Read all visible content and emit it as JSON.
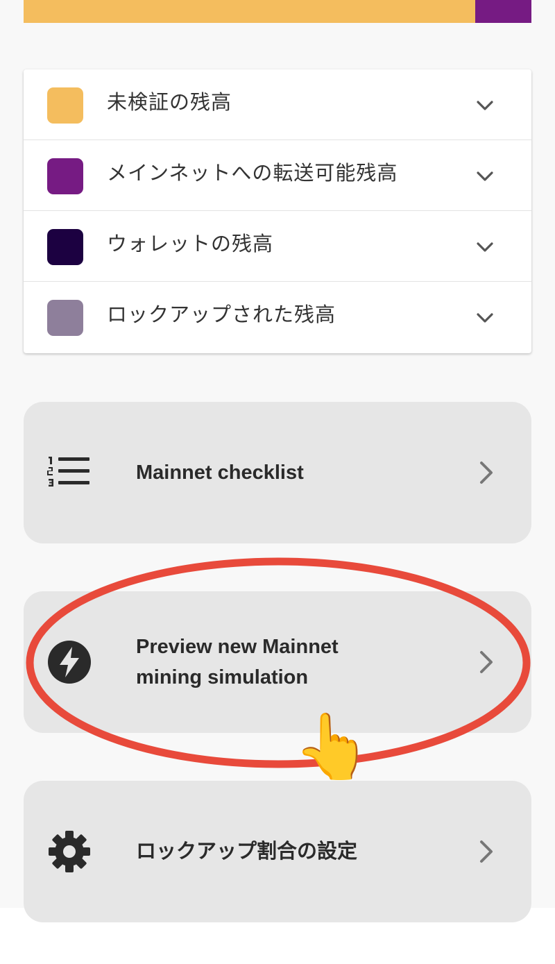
{
  "balance_bar": {
    "segments": [
      {
        "name": "未検証の残高",
        "fraction": 0.89,
        "color": "#F4BD5E"
      },
      {
        "name": "メインネットへの転送可能残高",
        "fraction": 0.11,
        "color": "#761B83"
      }
    ]
  },
  "legend": {
    "items": [
      {
        "label": "未検証の残高",
        "color": "#F4BD5E",
        "icon": "chevron-down-icon"
      },
      {
        "label": "メインネットへの転送可能残高",
        "color": "#761B83",
        "icon": "chevron-down-icon"
      },
      {
        "label": "ウォレットの残高",
        "color": "#1C0141",
        "icon": "chevron-down-icon"
      },
      {
        "label": "ロックアップされた残高",
        "color": "#8E7F9B",
        "icon": "chevron-down-icon"
      }
    ]
  },
  "actions": [
    {
      "label": "Mainnet checklist",
      "icon": "numbered-list-icon"
    },
    {
      "label_line1": "Preview new Mainnet",
      "label_line2": "mining simulation",
      "icon": "lightning-bolt-icon"
    },
    {
      "label": "ロックアップ割合の設定",
      "icon": "gear-icon"
    }
  ],
  "annotation": {
    "circle_color": "#E84A3B",
    "pointer": "👆"
  }
}
